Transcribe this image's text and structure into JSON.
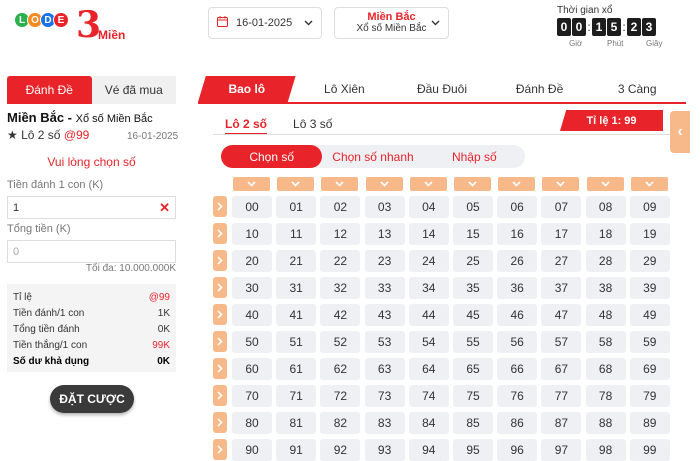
{
  "logo": {
    "balls": [
      "L",
      "O",
      "D",
      "E"
    ],
    "ball_colors": [
      "#2bb24c",
      "#f58a1f",
      "#1a73e8",
      "#e8232a"
    ],
    "three": "3",
    "mien": "Miền"
  },
  "header": {
    "date": "16-01-2025",
    "region_title": "Miền Bắc",
    "region_sub": "Xổ số Miền Bắc",
    "timer_label": "Thời gian xổ",
    "digits": [
      "0",
      "0",
      "1",
      "5",
      "2",
      "3"
    ],
    "units": [
      "Giờ",
      "Phút",
      "Giây"
    ]
  },
  "left": {
    "tabs": [
      "Đánh Đề",
      "Vé đã mua"
    ],
    "region": "Miền Bắc -",
    "region_sub": "Xổ số Miền Bắc",
    "bet_name": "★ Lô 2 số",
    "bet_odds": "@99",
    "date": "16-01-2025",
    "prompt": "Vui lòng chọn số",
    "per_label": "Tiền đánh 1 con (K)",
    "per_value": "1",
    "total_label": "Tổng tiền (K)",
    "total_placeholder": "0",
    "max": "Tối đa: 10.000.000K",
    "summary": [
      {
        "label": "Tỉ lệ",
        "value": "@99",
        "red": true
      },
      {
        "label": "Tiền đánh/1 con",
        "value": "1K"
      },
      {
        "label": "Tổng tiền đánh",
        "value": "0K"
      },
      {
        "label": "Tiền thắng/1 con",
        "value": "99K",
        "red": true
      },
      {
        "label": "Số dư khả dụng",
        "value": "0K",
        "bold": true
      }
    ],
    "bet_button": "ĐẶT CƯỢC"
  },
  "main": {
    "tabs": [
      "Bao lô",
      "Lô Xiên",
      "Đầu Đuôi",
      "Đánh Đề",
      "3 Càng"
    ],
    "sub_tabs": [
      "Lô 2 số",
      "Lô 3 số"
    ],
    "ratio_label": "Tỉ lệ",
    "ratio_value": "1: 99",
    "pick_modes": [
      "Chọn số",
      "Chọn số nhanh",
      "Nhập số"
    ],
    "numbers": [
      [
        "00",
        "01",
        "02",
        "03",
        "04",
        "05",
        "06",
        "07",
        "08",
        "09"
      ],
      [
        "10",
        "11",
        "12",
        "13",
        "14",
        "15",
        "16",
        "17",
        "18",
        "19"
      ],
      [
        "20",
        "21",
        "22",
        "23",
        "24",
        "25",
        "26",
        "27",
        "28",
        "29"
      ],
      [
        "30",
        "31",
        "32",
        "33",
        "34",
        "35",
        "36",
        "37",
        "38",
        "39"
      ],
      [
        "40",
        "41",
        "42",
        "43",
        "44",
        "45",
        "46",
        "47",
        "48",
        "49"
      ],
      [
        "50",
        "51",
        "52",
        "53",
        "54",
        "55",
        "56",
        "57",
        "58",
        "59"
      ],
      [
        "60",
        "61",
        "62",
        "63",
        "64",
        "65",
        "66",
        "67",
        "68",
        "69"
      ],
      [
        "70",
        "71",
        "72",
        "73",
        "74",
        "75",
        "76",
        "77",
        "78",
        "79"
      ],
      [
        "80",
        "81",
        "82",
        "83",
        "84",
        "85",
        "86",
        "87",
        "88",
        "89"
      ],
      [
        "90",
        "91",
        "92",
        "93",
        "94",
        "95",
        "96",
        "97",
        "98",
        "99"
      ]
    ]
  },
  "colors": {
    "accent": "#e8232a",
    "arrow": "#f7b98a",
    "cell": "#eef0f4"
  }
}
